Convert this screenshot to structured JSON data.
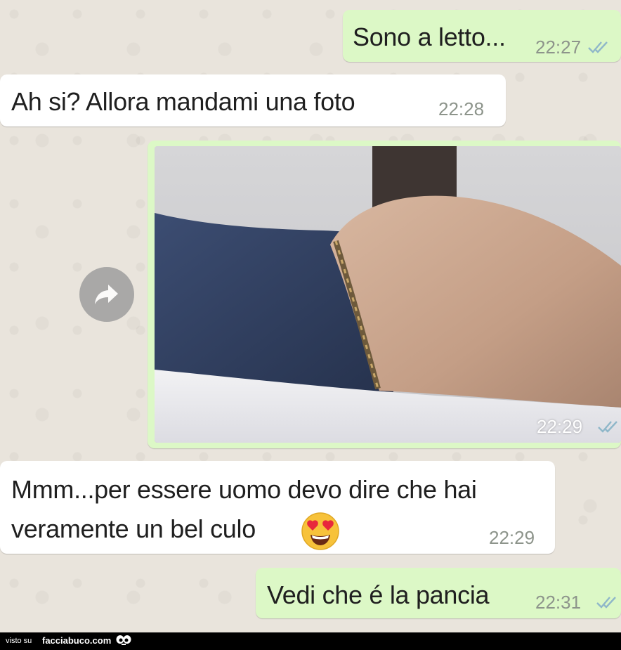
{
  "messages": [
    {
      "direction": "outgoing",
      "text": "Sono a letto...",
      "time": "22:27",
      "status": "read-ticks"
    },
    {
      "direction": "incoming",
      "text": "Ah si? Allora mandami una foto",
      "time": "22:28"
    },
    {
      "direction": "outgoing",
      "type": "photo",
      "time": "22:29",
      "status": "read-ticks",
      "forward_icon": "forward-arrow-icon"
    },
    {
      "direction": "incoming",
      "lines": [
        "Mmm...per essere uomo devo dire che hai",
        "veramente un bel culo"
      ],
      "emoji": "heart-eyes-emoji",
      "time": "22:29"
    },
    {
      "direction": "outgoing",
      "text": "Vedi che é la pancia",
      "time": "22:31",
      "status": "read-ticks"
    }
  ],
  "footer": {
    "prefix": "visto su",
    "site": "facciabuco.com",
    "logo_icon": "eyes-icon"
  },
  "colors": {
    "outgoing_bubble": "#dcf8c6",
    "incoming_bubble": "#ffffff",
    "chat_background": "#e9e4dc",
    "read_ticks": "#8fb7c9",
    "footer_background": "#000000"
  }
}
